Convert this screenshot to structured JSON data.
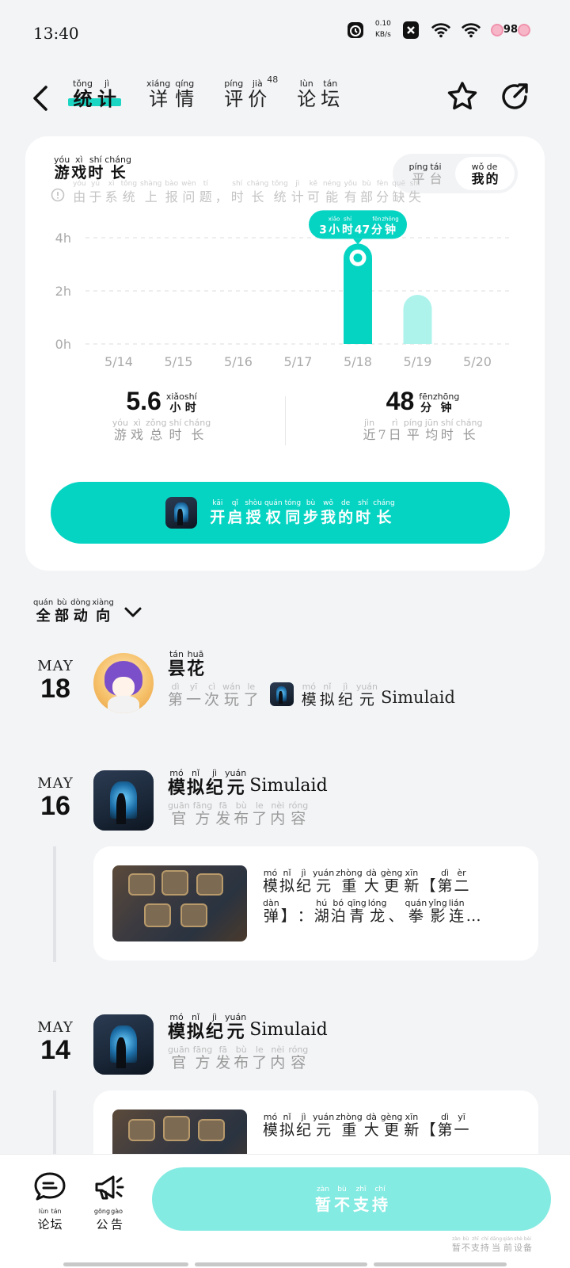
{
  "status_bar": {
    "time": "13:40",
    "net_speed_value": "0.10",
    "net_speed_unit": "KB/s",
    "battery": "98"
  },
  "header": {
    "tabs": [
      {
        "chars": [
          "统",
          "计"
        ],
        "pinyin": [
          "tǒng",
          "jì"
        ],
        "active": true
      },
      {
        "chars": [
          "详",
          "情"
        ],
        "pinyin": [
          "xiáng",
          "qíng"
        ],
        "active": false
      },
      {
        "chars": [
          "评",
          "价"
        ],
        "pinyin": [
          "píng",
          "jià"
        ],
        "active": false,
        "count": "48"
      },
      {
        "chars": [
          "论",
          "坛"
        ],
        "pinyin": [
          "lùn",
          "tán"
        ],
        "active": false
      }
    ]
  },
  "stats": {
    "title": {
      "chars": [
        "游",
        "戏",
        "时",
        "长"
      ],
      "pinyin": [
        "yóu",
        "xì",
        "shí",
        "cháng"
      ]
    },
    "toggle": [
      {
        "chars": [
          "平",
          "台"
        ],
        "pinyin": [
          "píng",
          "tái"
        ],
        "on": false
      },
      {
        "chars": [
          "我",
          "的"
        ],
        "pinyin": [
          "wǒ",
          "de"
        ],
        "on": true
      }
    ],
    "notice": {
      "chars": [
        "由",
        "于",
        "系",
        "统",
        "上",
        "报",
        "问",
        "题",
        "，",
        "时",
        "长",
        "统",
        "计",
        "可",
        "能",
        "有",
        "部",
        "分",
        "缺",
        "失"
      ],
      "pinyin": [
        "yóu",
        "yú",
        "xì",
        "tǒng",
        "shàng",
        "bào",
        "wèn",
        "tí",
        "",
        "shí",
        "cháng",
        "tǒng",
        "jì",
        "kě",
        "néng",
        "yǒu",
        "bù",
        "fèn",
        "quē",
        "shī"
      ]
    },
    "total": {
      "value": "5.6",
      "unit_chars": [
        "小",
        "时"
      ],
      "unit_pinyin": [
        "xiǎo",
        "shí"
      ],
      "label_chars": [
        "游",
        "戏",
        "总",
        "时",
        "长"
      ],
      "label_pinyin": [
        "yóu",
        "xì",
        "zǒng",
        "shí",
        "cháng"
      ]
    },
    "avg": {
      "value": "48",
      "unit_chars": [
        "分",
        "钟"
      ],
      "unit_pinyin": [
        "fēn",
        "zhōng"
      ],
      "label_chars": [
        "近",
        "7",
        "日",
        "平",
        "均",
        "时",
        "长"
      ],
      "label_pinyin": [
        "jìn",
        "",
        "rì",
        "píng",
        "jūn",
        "shí",
        "cháng"
      ]
    },
    "sync_button": {
      "chars": [
        "开",
        "启",
        "授",
        "权",
        "同",
        "步",
        "我",
        "的",
        "时",
        "长"
      ],
      "pinyin": [
        "kāi",
        "qǐ",
        "shòu",
        "quán",
        "tóng",
        "bù",
        "wǒ",
        "de",
        "shí",
        "cháng"
      ]
    }
  },
  "chart_data": {
    "type": "bar",
    "categories": [
      "5/14",
      "5/15",
      "5/16",
      "5/17",
      "5/18",
      "5/19",
      "5/20"
    ],
    "values": [
      0,
      0,
      0,
      0,
      3.78,
      1.85,
      0
    ],
    "y_ticks": [
      "0h",
      "2h",
      "4h"
    ],
    "ylim": [
      0,
      4.6
    ],
    "highlight_index": 4,
    "tooltip": {
      "chars": [
        "3",
        "小",
        "时",
        "47",
        "分",
        "钟"
      ],
      "pinyin": [
        "",
        "xiǎo",
        "shí",
        "",
        "fēn",
        "zhōng"
      ]
    },
    "grid": true,
    "colors": {
      "highlight": "#06d4c3",
      "normal": "#adf3ec"
    }
  },
  "feed": {
    "title": {
      "chars": [
        "全",
        "部",
        "动",
        "向"
      ],
      "pinyin": [
        "quán",
        "bù",
        "dòng",
        "xiàng"
      ]
    },
    "items": [
      {
        "month": "MAY",
        "day": "18",
        "name_chars": [
          "昙",
          "花"
        ],
        "name_pinyin": [
          "tán",
          "huā"
        ],
        "name_en": "",
        "action_chars": [
          "第",
          "一",
          "次",
          "玩",
          "了"
        ],
        "action_pinyin": [
          "dì",
          "yī",
          "cì",
          "wán",
          "le"
        ],
        "game_chars": [
          "模",
          "拟",
          "纪",
          "元"
        ],
        "game_pinyin": [
          "mó",
          "nǐ",
          "jì",
          "yuán"
        ],
        "game_en": "Simulaid"
      },
      {
        "month": "MAY",
        "day": "16",
        "name_chars": [
          "模",
          "拟",
          "纪",
          "元"
        ],
        "name_pinyin": [
          "mó",
          "nǐ",
          "jì",
          "yuán"
        ],
        "name_en": "Simulaid",
        "action_chars": [
          "官",
          "方",
          "发",
          "布",
          "了",
          "内",
          "容"
        ],
        "action_pinyin": [
          "guān",
          "fāng",
          "fā",
          "bù",
          "le",
          "nèi",
          "róng"
        ],
        "post_line1_chars": [
          "模",
          "拟",
          "纪",
          "元",
          "重",
          "大",
          "更",
          "新",
          "【",
          "第",
          "二"
        ],
        "post_line1_pinyin": [
          "mó",
          "nǐ",
          "jì",
          "yuán",
          "zhòng",
          "dà",
          "gèng",
          "xīn",
          "",
          "dì",
          "èr"
        ],
        "post_line2_chars": [
          "弹",
          "】",
          "：",
          "湖",
          "泊",
          "青",
          "龙",
          "、",
          "拳",
          "影",
          "连",
          "…"
        ],
        "post_line2_pinyin": [
          "dàn",
          "",
          "",
          "hú",
          "bó",
          "qīng",
          "lóng",
          "",
          "quán",
          "yǐng",
          "lián",
          ""
        ]
      },
      {
        "month": "MAY",
        "day": "14",
        "name_chars": [
          "模",
          "拟",
          "纪",
          "元"
        ],
        "name_pinyin": [
          "mó",
          "nǐ",
          "jì",
          "yuán"
        ],
        "name_en": "Simulaid",
        "action_chars": [
          "官",
          "方",
          "发",
          "布",
          "了",
          "内",
          "容"
        ],
        "action_pinyin": [
          "guān",
          "fāng",
          "fā",
          "bù",
          "le",
          "nèi",
          "róng"
        ],
        "post_line1_chars": [
          "模",
          "拟",
          "纪",
          "元",
          "重",
          "大",
          "更",
          "新",
          "【",
          "第",
          "一"
        ],
        "post_line1_pinyin": [
          "mó",
          "nǐ",
          "jì",
          "yuán",
          "zhòng",
          "dà",
          "gèng",
          "xīn",
          "",
          "dì",
          "yī"
        ]
      }
    ]
  },
  "bottom_bar": {
    "forum": {
      "chars": [
        "论",
        "坛"
      ],
      "pinyin": [
        "lùn",
        "tán"
      ]
    },
    "announce": {
      "chars": [
        "公",
        "告"
      ],
      "pinyin": [
        "gōng",
        "gào"
      ]
    },
    "cta": {
      "chars": [
        "暂",
        "不",
        "支",
        "持"
      ],
      "pinyin": [
        "zàn",
        "bù",
        "zhī",
        "chí"
      ]
    },
    "cta_note": {
      "chars": [
        "暂",
        "不",
        "支",
        "持",
        "当",
        "前",
        "设",
        "备"
      ],
      "pinyin": [
        "zàn",
        "bù",
        "zhī",
        "chí",
        "dāng",
        "qián",
        "shè",
        "bèi"
      ]
    }
  }
}
